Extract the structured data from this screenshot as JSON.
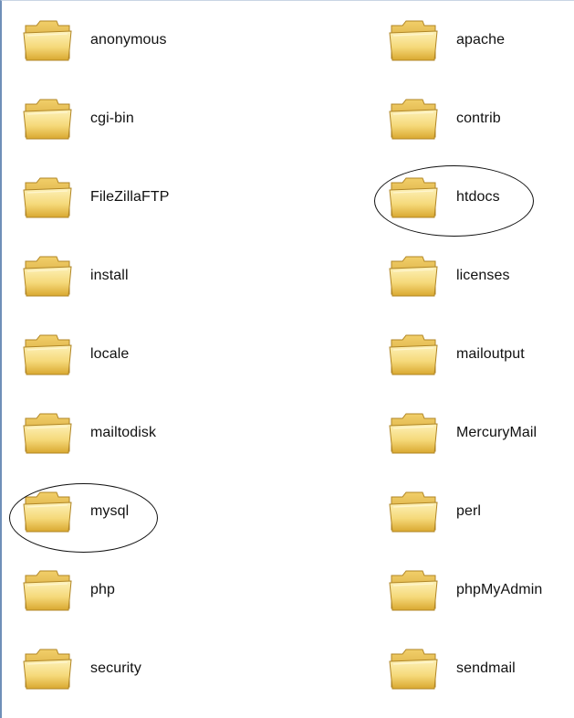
{
  "folders": [
    {
      "name": "anonymous"
    },
    {
      "name": "apache"
    },
    {
      "name": "cgi-bin"
    },
    {
      "name": "contrib"
    },
    {
      "name": "FileZillaFTP"
    },
    {
      "name": "htdocs"
    },
    {
      "name": "install"
    },
    {
      "name": "licenses"
    },
    {
      "name": "locale"
    },
    {
      "name": "mailoutput"
    },
    {
      "name": "mailtodisk"
    },
    {
      "name": "MercuryMail"
    },
    {
      "name": "mysql"
    },
    {
      "name": "perl"
    },
    {
      "name": "php"
    },
    {
      "name": "phpMyAdmin"
    },
    {
      "name": "security"
    },
    {
      "name": "sendmail"
    }
  ],
  "highlighted": [
    "htdocs",
    "mysql"
  ],
  "colors": {
    "folder_light": "#fdf1b8",
    "folder_mid": "#f5d97a",
    "folder_dark": "#d9a830",
    "folder_outline": "#b08524",
    "annotation": "#111111"
  },
  "icon": "folder-icon"
}
